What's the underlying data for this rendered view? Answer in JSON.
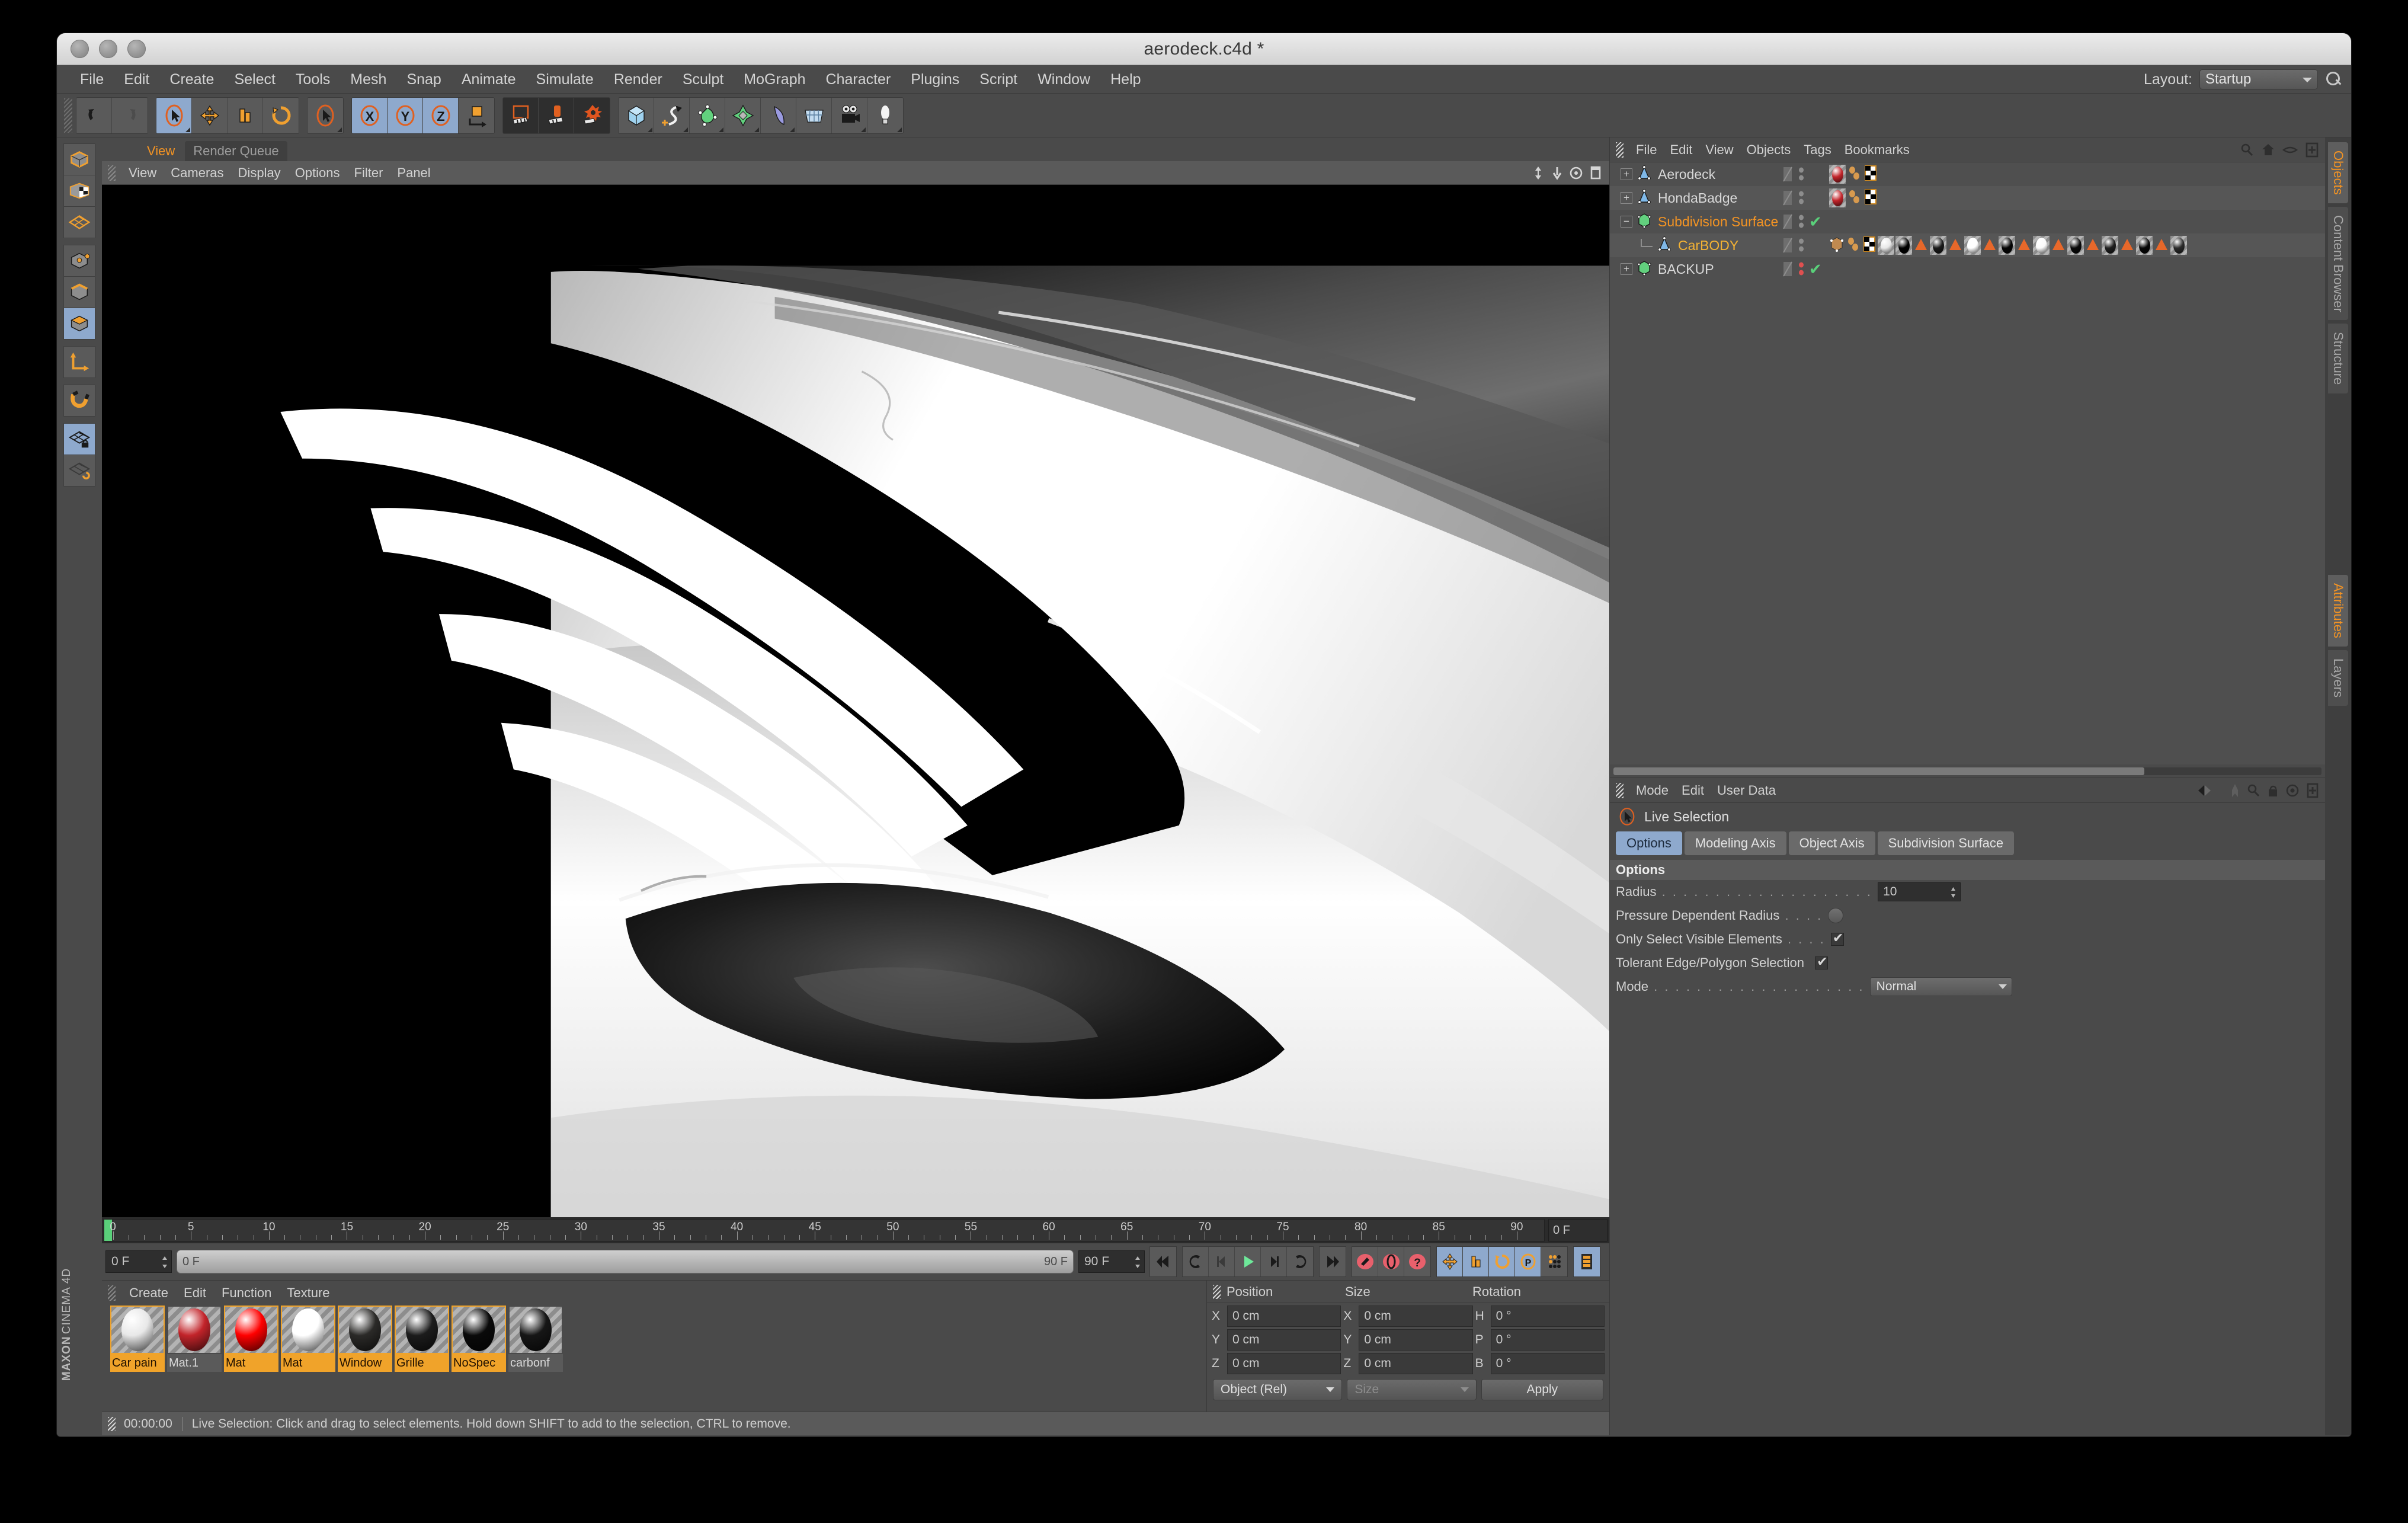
{
  "window": {
    "title": "aerodeck.c4d *"
  },
  "menubar": {
    "items": [
      "File",
      "Edit",
      "Create",
      "Select",
      "Tools",
      "Mesh",
      "Snap",
      "Animate",
      "Simulate",
      "Render",
      "Sculpt",
      "MoGraph",
      "Character",
      "Plugins",
      "Script",
      "Window",
      "Help"
    ],
    "layout_label": "Layout:",
    "layout_value": "Startup"
  },
  "toolbar": {
    "groups": [
      {
        "buttons": [
          {
            "icon": "undo-icon",
            "state": "normal"
          },
          {
            "icon": "redo-icon",
            "state": "disabled"
          }
        ]
      },
      {
        "buttons": [
          {
            "icon": "live-selection-icon",
            "state": "selected"
          },
          {
            "icon": "move-icon",
            "state": "normal"
          },
          {
            "icon": "scale-icon",
            "state": "normal"
          },
          {
            "icon": "rotate-icon",
            "state": "normal"
          }
        ]
      },
      {
        "buttons": [
          {
            "icon": "selection-tool-icon",
            "state": "normal"
          }
        ]
      },
      {
        "buttons": [
          {
            "icon": "axis-x-icon",
            "label": "X",
            "state": "selected"
          },
          {
            "icon": "axis-y-icon",
            "label": "Y",
            "state": "selected"
          },
          {
            "icon": "axis-z-icon",
            "label": "Z",
            "state": "selected"
          },
          {
            "icon": "world-object-axis-icon",
            "state": "normal"
          }
        ]
      },
      {
        "buttons": [
          {
            "icon": "render-view-icon",
            "state": "dark"
          },
          {
            "icon": "render-region-icon",
            "state": "dark"
          },
          {
            "icon": "render-settings-icon",
            "state": "dark"
          }
        ]
      },
      {
        "buttons": [
          {
            "icon": "primitive-cube-icon",
            "state": "normal"
          },
          {
            "icon": "spline-pen-icon",
            "state": "normal"
          },
          {
            "icon": "nurbs-icon",
            "state": "normal"
          },
          {
            "icon": "array-icon",
            "state": "normal"
          },
          {
            "icon": "deformer-icon",
            "state": "normal"
          },
          {
            "icon": "environment-icon",
            "state": "normal"
          },
          {
            "icon": "camera-icon",
            "state": "normal"
          },
          {
            "icon": "light-icon",
            "state": "normal"
          }
        ]
      }
    ]
  },
  "left_toolbar": {
    "items": [
      {
        "icon": "model-mode-icon",
        "state": "normal"
      },
      {
        "icon": "texture-mode-icon",
        "state": "normal"
      },
      {
        "icon": "workplane-mode-icon",
        "state": "normal"
      },
      {
        "icon": "point-mode-icon",
        "state": "normal"
      },
      {
        "icon": "edge-mode-icon",
        "state": "normal"
      },
      {
        "icon": "polygon-mode-icon",
        "state": "selected"
      },
      {
        "icon": "axis-mode-icon",
        "state": "normal"
      },
      {
        "icon": "enable-snap-icon",
        "state": "normal"
      },
      {
        "icon": "lock-workplane-icon",
        "state": "selected"
      },
      {
        "icon": "planar-workplane-icon",
        "state": "normal"
      }
    ],
    "brand_top": "MAXON",
    "brand_bottom": "CINEMA 4D"
  },
  "viewport": {
    "tabs": [
      {
        "label": "View",
        "active": true
      },
      {
        "label": "Render Queue",
        "active": false
      }
    ],
    "menu": [
      "View",
      "Cameras",
      "Display",
      "Options",
      "Filter",
      "Panel"
    ],
    "icons": [
      "pan-icon",
      "zoom-icon",
      "rotate-view-icon",
      "maximize-view-icon"
    ]
  },
  "timeline": {
    "ticks": [
      "0",
      "5",
      "10",
      "15",
      "20",
      "25",
      "30",
      "35",
      "40",
      "45",
      "50",
      "55",
      "60",
      "65",
      "70",
      "75",
      "80",
      "85",
      "90"
    ],
    "current_frame_field": "0 F",
    "playhead_frame": 0
  },
  "transport": {
    "start_field": "0 F",
    "range_start": "0 F",
    "range_end": "90 F",
    "end_field": "90 F",
    "buttons": [
      {
        "icon": "go-to-start-icon",
        "state": "normal"
      },
      {
        "icon": "previous-key-icon",
        "state": "normal"
      },
      {
        "icon": "step-back-icon",
        "state": "normal"
      },
      {
        "icon": "play-icon",
        "state": "normal"
      },
      {
        "icon": "step-forward-icon",
        "state": "normal"
      },
      {
        "icon": "next-key-icon",
        "state": "normal"
      },
      {
        "icon": "go-to-end-icon",
        "state": "normal"
      },
      {
        "icon": "record-key-icon",
        "state": "normal"
      },
      {
        "icon": "autokey-icon",
        "state": "normal"
      },
      {
        "icon": "keyframe-selection-icon",
        "state": "normal"
      },
      {
        "icon": "record-position-icon",
        "state": "selected"
      },
      {
        "icon": "record-scale-icon",
        "state": "selected"
      },
      {
        "icon": "record-rotation-icon",
        "state": "selected"
      },
      {
        "icon": "record-param-icon",
        "state": "selected"
      },
      {
        "icon": "point-level-anim-icon",
        "state": "normal"
      },
      {
        "icon": "timeline-icon",
        "state": "selected"
      }
    ]
  },
  "materials": {
    "menu": [
      "Create",
      "Edit",
      "Function",
      "Texture"
    ],
    "items": [
      {
        "name": "Car pain",
        "color": "#e8e8e8",
        "selected": true
      },
      {
        "name": "Mat.1",
        "color": "#c2242a",
        "selected": false
      },
      {
        "name": "Mat",
        "color": "#ff0000",
        "selected": true
      },
      {
        "name": "Mat",
        "color": "#ffffff",
        "selected": true
      },
      {
        "name": "Window",
        "color": "#2b2a28",
        "selected": true
      },
      {
        "name": "Grille",
        "color": "#1c1c1c",
        "selected": true
      },
      {
        "name": "NoSpec",
        "color": "#0a0a0a",
        "selected": true
      },
      {
        "name": "carbonf",
        "color": "#161616",
        "selected": false
      }
    ]
  },
  "coordinates": {
    "headers": [
      "Position",
      "Size",
      "Rotation"
    ],
    "rows": [
      {
        "plabel": "X",
        "pvalue": "0 cm",
        "slabel": "X",
        "svalue": "0 cm",
        "rlabel": "H",
        "rvalue": "0 °"
      },
      {
        "plabel": "Y",
        "pvalue": "0 cm",
        "slabel": "Y",
        "svalue": "0 cm",
        "rlabel": "P",
        "rvalue": "0 °"
      },
      {
        "plabel": "Z",
        "pvalue": "0 cm",
        "slabel": "Z",
        "svalue": "0 cm",
        "rlabel": "B",
        "rvalue": "0 °"
      }
    ],
    "mode_dropdown": "Object (Rel)",
    "size_dropdown": "Size",
    "apply_button": "Apply"
  },
  "status": {
    "time": "00:00:00",
    "message": "Live Selection: Click and drag to select elements. Hold down SHIFT to add to the selection, CTRL to remove."
  },
  "objects_panel": {
    "menu": [
      "File",
      "Edit",
      "View",
      "Objects",
      "Tags",
      "Bookmarks"
    ],
    "icons": [
      "search-icon",
      "home-icon",
      "eye-icon",
      "add-layer-icon"
    ],
    "rows": [
      {
        "name": "Aerodeck",
        "type": "null-object",
        "indent": 0,
        "expandable": true,
        "expanded": false,
        "color": "#d8d8d8",
        "has_check": false,
        "tags": [
          {
            "kind": "material",
            "color": "#c2242a"
          },
          {
            "kind": "phong"
          },
          {
            "kind": "texture"
          }
        ]
      },
      {
        "name": "HondaBadge",
        "type": "null-object",
        "indent": 0,
        "expandable": true,
        "expanded": false,
        "color": "#d8d8d8",
        "has_check": false,
        "tags": [
          {
            "kind": "material",
            "color": "#c2242a"
          },
          {
            "kind": "phong"
          },
          {
            "kind": "texture"
          }
        ]
      },
      {
        "name": "Subdivision Surface",
        "type": "generator",
        "indent": 0,
        "expandable": true,
        "expanded": true,
        "color": "#f29324",
        "has_check": true,
        "tags": []
      },
      {
        "name": "CarBODY",
        "type": "polygon-object",
        "indent": 1,
        "expandable": false,
        "expanded": false,
        "color": "#f2b134",
        "has_check": false,
        "tags": [
          {
            "kind": "box"
          },
          {
            "kind": "phong"
          },
          {
            "kind": "texture"
          },
          {
            "kind": "material",
            "color": "#e8e8e8"
          },
          {
            "kind": "material",
            "color": "#000000"
          },
          {
            "kind": "selection"
          },
          {
            "kind": "material",
            "color": "#1a1a1a"
          },
          {
            "kind": "selection"
          },
          {
            "kind": "material",
            "color": "#ffffff"
          },
          {
            "kind": "selection"
          },
          {
            "kind": "material",
            "color": "#050505"
          },
          {
            "kind": "selection"
          },
          {
            "kind": "material",
            "color": "#fafafa"
          },
          {
            "kind": "selection"
          },
          {
            "kind": "material",
            "color": "#0a0a0a"
          },
          {
            "kind": "selection"
          },
          {
            "kind": "material",
            "color": "#1f1f1f"
          },
          {
            "kind": "selection"
          },
          {
            "kind": "material",
            "color": "#060606"
          },
          {
            "kind": "selection"
          },
          {
            "kind": "material",
            "color": "#2b2b2b"
          }
        ]
      },
      {
        "name": "BACKUP",
        "type": "generator",
        "indent": 0,
        "expandable": true,
        "expanded": false,
        "color": "#d8d8d8",
        "has_check": true,
        "tags": []
      }
    ],
    "side_tabs": [
      {
        "label": "Objects",
        "active": true
      },
      {
        "label": "Content Browser",
        "active": false
      },
      {
        "label": "Structure",
        "active": false
      }
    ]
  },
  "attributes_panel": {
    "menu": [
      "Mode",
      "Edit",
      "User Data"
    ],
    "icons": [
      "back-forward-icon",
      "pin-icon",
      "search-icon",
      "lock-icon",
      "target-icon",
      "add-icon"
    ],
    "tool_name": "Live Selection",
    "tool_icon": "live-selection-icon",
    "tabs": [
      {
        "label": "Options",
        "active": true
      },
      {
        "label": "Modeling Axis",
        "active": false
      },
      {
        "label": "Object Axis",
        "active": false
      },
      {
        "label": "Subdivision Surface",
        "active": false
      }
    ],
    "section_title": "Options",
    "fields": [
      {
        "label": "Radius",
        "dots": ". . . . . . . . . . . . . . . . . . . .",
        "control": "number",
        "value": "10"
      },
      {
        "label": "Pressure Dependent Radius",
        "dots": ". . . .",
        "control": "pill",
        "value": ""
      },
      {
        "label": "Only Select Visible Elements",
        "dots": ". . . .",
        "control": "checkbox",
        "value": "on"
      },
      {
        "label": "Tolerant Edge/Polygon Selection",
        "dots": "",
        "control": "checkbox",
        "value": "on"
      },
      {
        "label": "Mode",
        "dots": ". . . . . . . . . . . . . . . . . . . .",
        "control": "dropdown",
        "value": "Normal"
      }
    ],
    "side_tabs": [
      {
        "label": "Attributes",
        "active": true
      },
      {
        "label": "Layers",
        "active": false
      }
    ]
  }
}
